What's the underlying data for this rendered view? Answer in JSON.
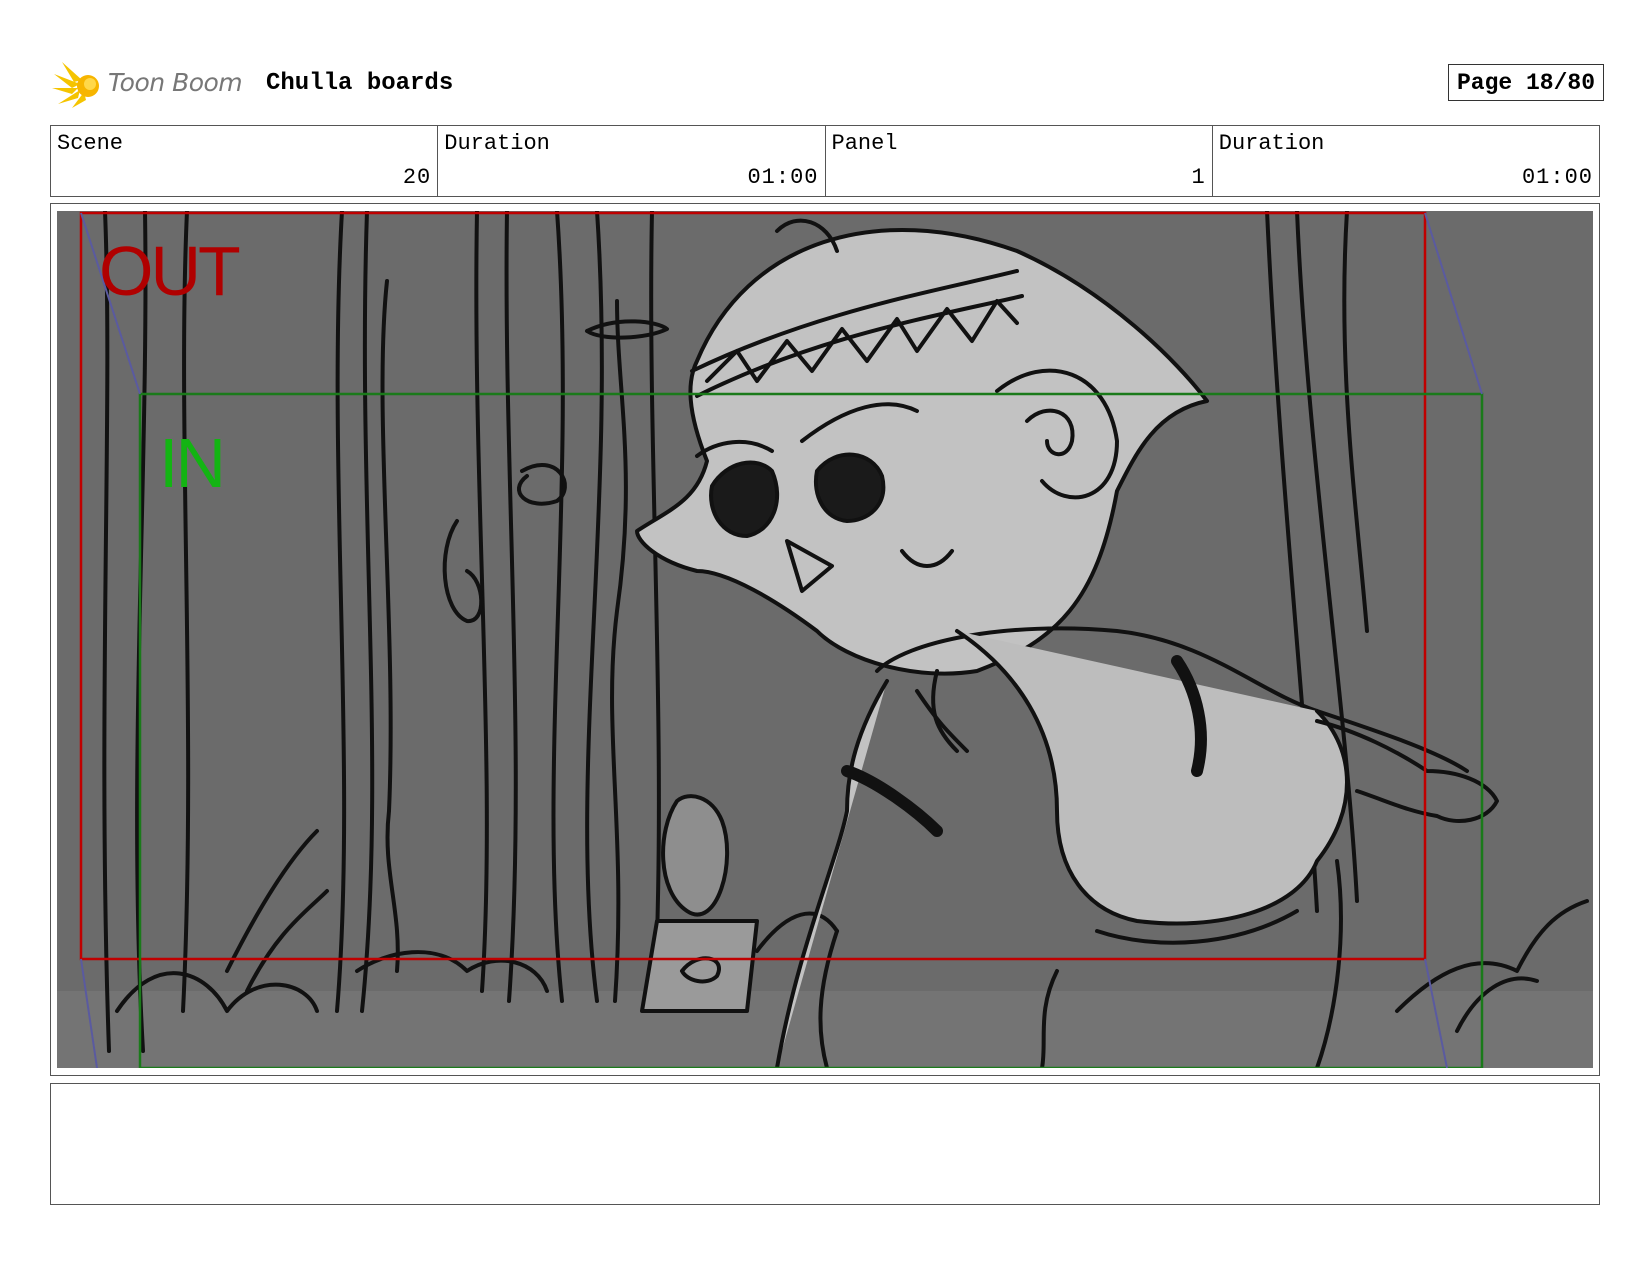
{
  "header": {
    "logo_text": "Toon Boom",
    "project_title": "Chulla boards",
    "page_label": "Page 18/80"
  },
  "info": {
    "scene_label": "Scene",
    "scene_value": "20",
    "scene_duration_label": "Duration",
    "scene_duration_value": "01:00",
    "panel_label": "Panel",
    "panel_value": "1",
    "panel_duration_label": "Duration",
    "panel_duration_value": "01:00"
  },
  "panel": {
    "out_label": "OUT",
    "in_label": "IN",
    "colors": {
      "background": "#6b6b6b",
      "out_frame": "#c00000",
      "in_frame": "#1a7a1a",
      "ink": "#111111",
      "character_fill": "#c2c2c2"
    }
  },
  "notes": {
    "text": ""
  }
}
